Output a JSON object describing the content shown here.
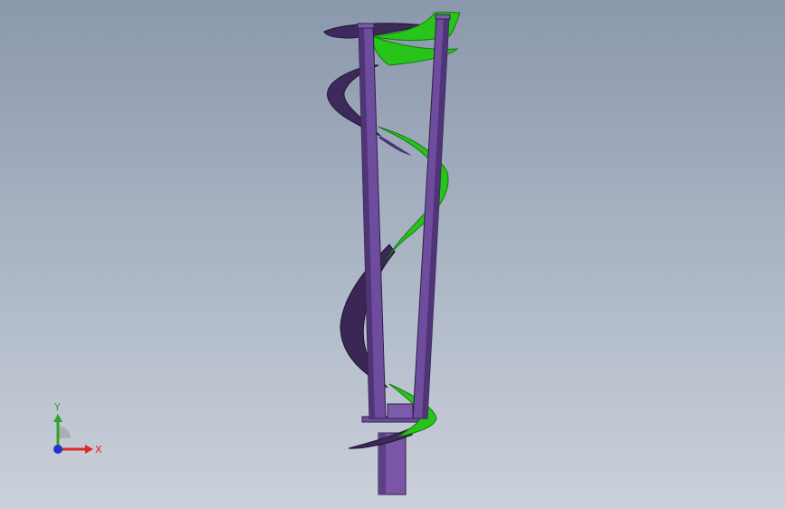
{
  "triad": {
    "x_label": "X",
    "y_label": "Y",
    "colors": {
      "x": "#e0262a",
      "y": "#2aa52a",
      "z": "#2233cc"
    }
  },
  "model": {
    "colors": {
      "blade_dark": "#3d2a5c",
      "blade_green": "#27c41a",
      "strut": "#6e4c9e",
      "strut_edge": "#2e1f47",
      "shaft": "#7a55a8"
    }
  }
}
